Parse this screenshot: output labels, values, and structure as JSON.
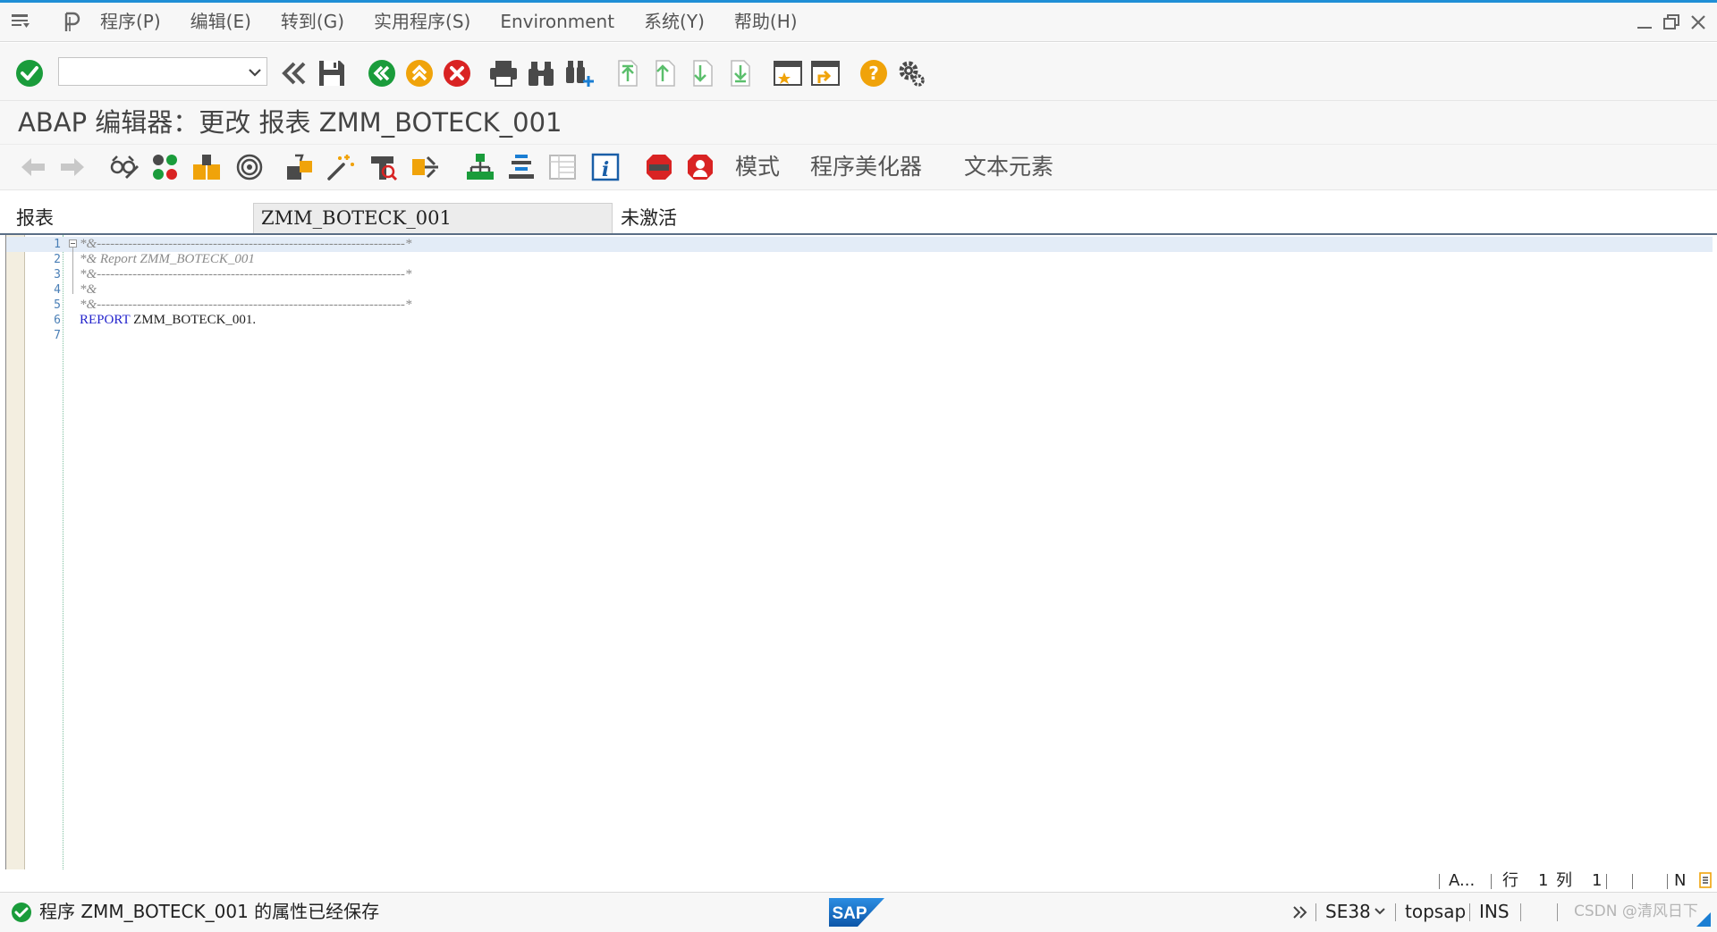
{
  "menu": {
    "items": [
      "程序(P)",
      "编辑(E)",
      "转到(G)",
      "实用程序(S)",
      "Environment",
      "系统(Y)",
      "帮助(H)"
    ]
  },
  "toolbar": {
    "command_field_value": "",
    "icons": [
      "enter-check-icon",
      "back-icon",
      "save-icon",
      "exit-icon",
      "up-icon",
      "cancel-icon",
      "print-icon",
      "find-icon",
      "find-next-icon",
      "first-page-icon",
      "previous-page-icon",
      "next-page-icon",
      "last-page-icon",
      "new-session-icon",
      "shortcut-icon",
      "help-icon",
      "settings-icon"
    ]
  },
  "title": "ABAP 编辑器：更改 报表 ZMM_BOTECK_001",
  "app_toolbar": {
    "buttons": [
      "模式",
      "程序美化器",
      "文本元素"
    ]
  },
  "report_field": {
    "label": "报表",
    "value": "ZMM_BOTECK_001",
    "status": "未激活"
  },
  "editor": {
    "lines": [
      {
        "num": "1",
        "text": "*&---------------------------------------------------------------------*"
      },
      {
        "num": "2",
        "text": "*& Report ZMM_BOTECK_001"
      },
      {
        "num": "3",
        "text": "*&---------------------------------------------------------------------*"
      },
      {
        "num": "4",
        "text": "*&"
      },
      {
        "num": "5",
        "text": "*&---------------------------------------------------------------------*"
      },
      {
        "num": "6",
        "keyword": "REPORT",
        "rest": " ZMM_BOTECK_001."
      },
      {
        "num": "7",
        "text": ""
      }
    ]
  },
  "status_info": {
    "a": "A...",
    "line_label": "行",
    "line_value": "1",
    "col_label": "列",
    "col_value": "1",
    "n": "N"
  },
  "statusbar": {
    "message": "程序 ZMM_BOTECK_001 的属性已经保存",
    "sap_logo": "SAP",
    "transaction": "SE38",
    "server": "topsap",
    "mode": "INS",
    "watermark": "CSDN @清风日下"
  },
  "colors": {
    "accent_blue": "#1f8fd6",
    "ok_green": "#1a9c3b",
    "cancel_red": "#d92323",
    "help_orange": "#f0a30a",
    "keyword_blue": "#2222cc",
    "sap_blue": "#1a6dc1"
  }
}
